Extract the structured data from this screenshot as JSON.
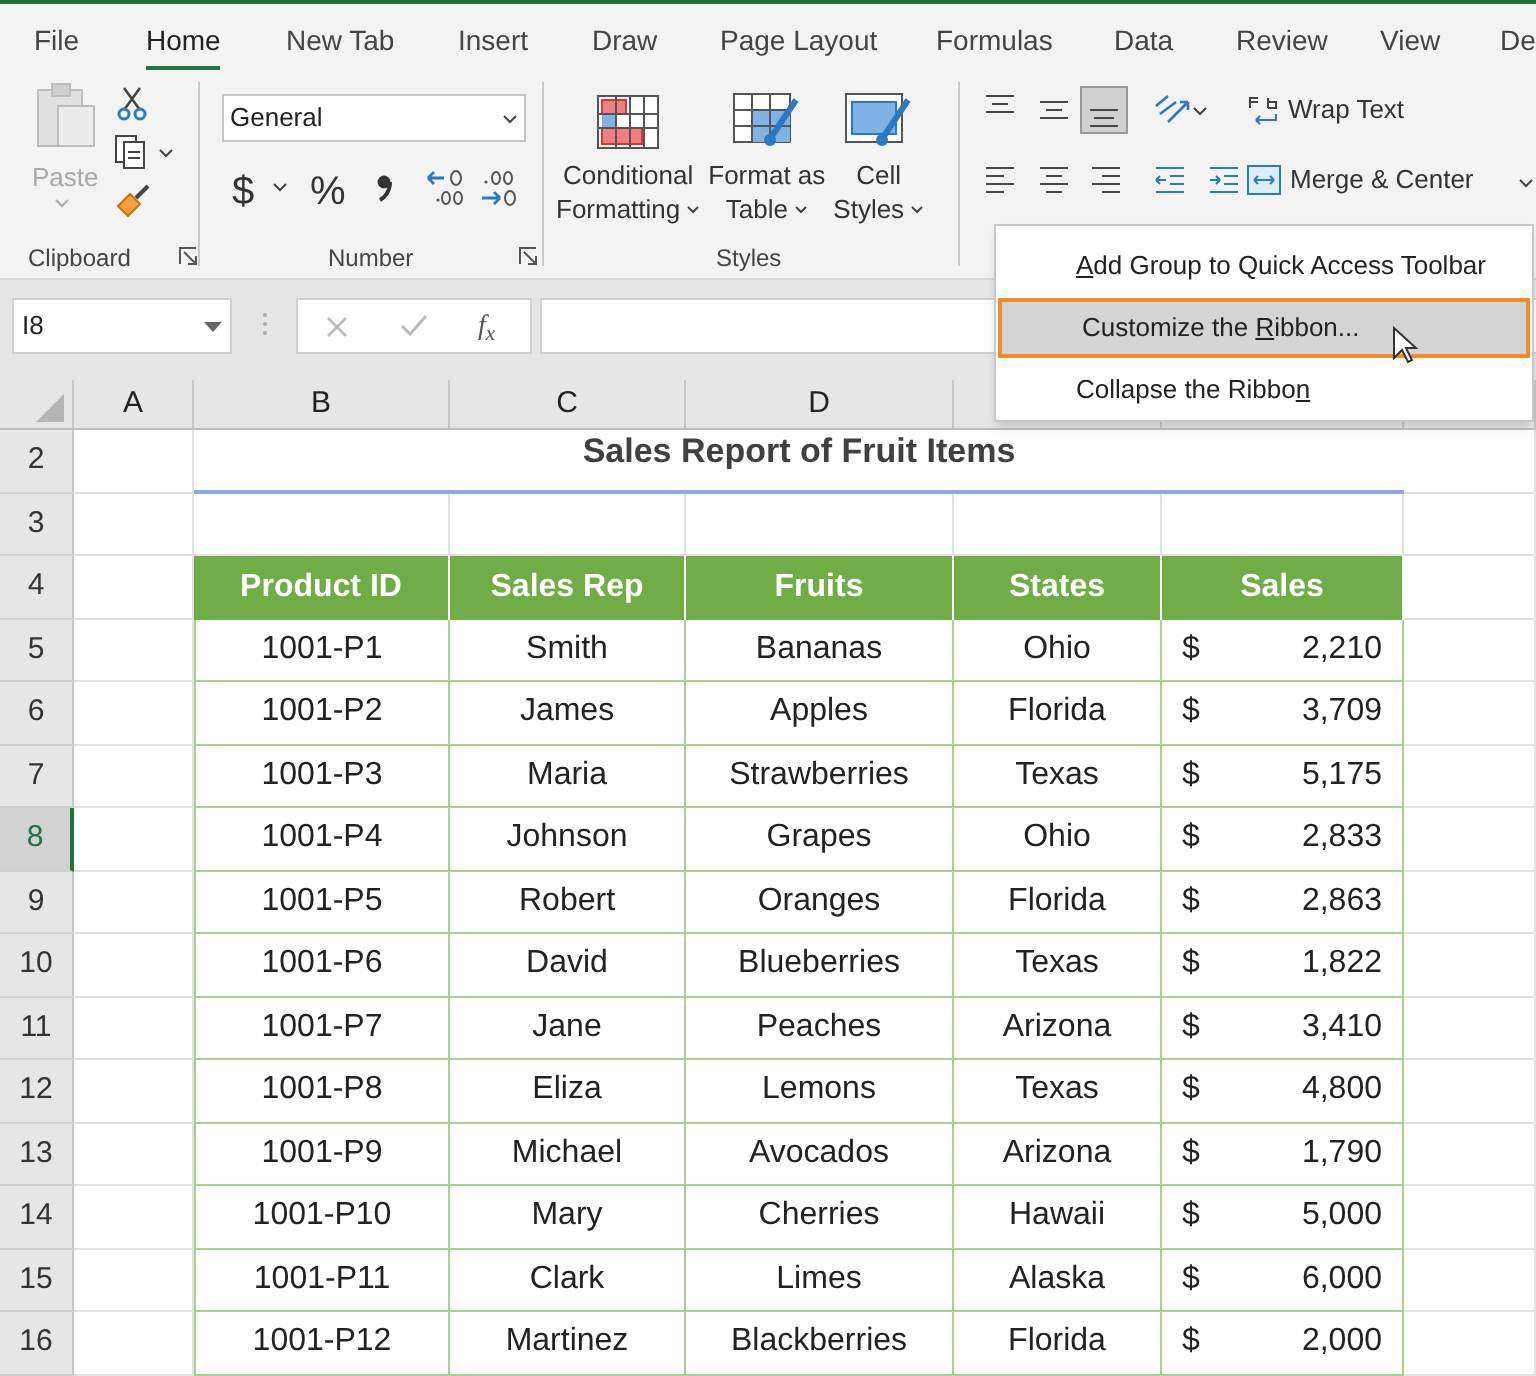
{
  "menu_tabs": [
    {
      "label": "File",
      "selected": false
    },
    {
      "label": "Home",
      "selected": true
    },
    {
      "label": "New Tab",
      "selected": false
    },
    {
      "label": "Insert",
      "selected": false
    },
    {
      "label": "Draw",
      "selected": false
    },
    {
      "label": "Page Layout",
      "selected": false
    },
    {
      "label": "Formulas",
      "selected": false
    },
    {
      "label": "Data",
      "selected": false
    },
    {
      "label": "Review",
      "selected": false
    },
    {
      "label": "View",
      "selected": false
    },
    {
      "label": "De",
      "selected": false
    }
  ],
  "clipboard": {
    "paste": "Paste",
    "label": "Clipboard"
  },
  "number": {
    "format": "General",
    "currency": "$",
    "percent": "%",
    "label": "Number"
  },
  "styles": {
    "buttons": [
      {
        "line1": "Conditional",
        "line2": "Formatting",
        "kind": "conditional"
      },
      {
        "line1": "Format as",
        "line2": "Table",
        "kind": "table"
      },
      {
        "line1": "Cell",
        "line2": "Styles",
        "kind": "cell"
      }
    ],
    "label": "Styles"
  },
  "alignment": {
    "wrap_text": "Wrap Text",
    "merge": "Merge & Center"
  },
  "name_box": "I8",
  "insert_function": "f$_{x}$",
  "column_headers": [
    "A",
    "B",
    "C",
    "D"
  ],
  "row_headers": [
    {
      "label": "2",
      "selected": false
    },
    {
      "label": "3",
      "selected": false
    },
    {
      "label": "4",
      "selected": false
    },
    {
      "label": "5",
      "selected": false
    },
    {
      "label": "6",
      "selected": false
    },
    {
      "label": "7",
      "selected": false
    },
    {
      "label": "8",
      "selected": true
    },
    {
      "label": "9",
      "selected": false
    },
    {
      "label": "10",
      "selected": false
    },
    {
      "label": "11",
      "selected": false
    },
    {
      "label": "12",
      "selected": false
    },
    {
      "label": "13",
      "selected": false
    },
    {
      "label": "14",
      "selected": false
    },
    {
      "label": "15",
      "selected": false
    },
    {
      "label": "16",
      "selected": false
    }
  ],
  "title": "Sales Report of Fruit Items",
  "table": {
    "columns": [
      "Product ID",
      "Sales Rep",
      "Fruits",
      "States",
      "Sales"
    ],
    "rows": [
      {
        "product_id": "1001-P1",
        "sales_rep": "Smith",
        "fruit": "Bananas",
        "state": "Ohio",
        "currency": "$",
        "sales": "2,210"
      },
      {
        "product_id": "1001-P2",
        "sales_rep": "James",
        "fruit": "Apples",
        "state": "Florida",
        "currency": "$",
        "sales": "3,709"
      },
      {
        "product_id": "1001-P3",
        "sales_rep": "Maria",
        "fruit": "Strawberries",
        "state": "Texas",
        "currency": "$",
        "sales": "5,175"
      },
      {
        "product_id": "1001-P4",
        "sales_rep": "Johnson",
        "fruit": "Grapes",
        "state": "Ohio",
        "currency": "$",
        "sales": "2,833"
      },
      {
        "product_id": "1001-P5",
        "sales_rep": "Robert",
        "fruit": "Oranges",
        "state": "Florida",
        "currency": "$",
        "sales": "2,863"
      },
      {
        "product_id": "1001-P6",
        "sales_rep": "David",
        "fruit": "Blueberries",
        "state": "Texas",
        "currency": "$",
        "sales": "1,822"
      },
      {
        "product_id": "1001-P7",
        "sales_rep": "Jane",
        "fruit": "Peaches",
        "state": "Arizona",
        "currency": "$",
        "sales": "3,410"
      },
      {
        "product_id": "1001-P8",
        "sales_rep": "Eliza",
        "fruit": "Lemons",
        "state": "Texas",
        "currency": "$",
        "sales": "4,800"
      },
      {
        "product_id": "1001-P9",
        "sales_rep": "Michael",
        "fruit": "Avocados",
        "state": "Arizona",
        "currency": "$",
        "sales": "1,790"
      },
      {
        "product_id": "1001-P10",
        "sales_rep": "Mary",
        "fruit": "Cherries",
        "state": "Hawaii",
        "currency": "$",
        "sales": "5,000"
      },
      {
        "product_id": "1001-P11",
        "sales_rep": "Clark",
        "fruit": "Limes",
        "state": "Alaska",
        "currency": "$",
        "sales": "6,000"
      },
      {
        "product_id": "1001-P12",
        "sales_rep": "Martinez",
        "fruit": "Blackberries",
        "state": "Florida",
        "currency": "$",
        "sales": "2,000"
      }
    ]
  },
  "context_menu": [
    {
      "key": "A",
      "after": "dd Group to Quick Access Toolbar",
      "selected": false
    },
    {
      "before": "Customize the ",
      "key": "R",
      "after": "ibbon...",
      "selected": true
    },
    {
      "before": "Collapse the Ribbo",
      "key": "n",
      "selected": false
    }
  ]
}
